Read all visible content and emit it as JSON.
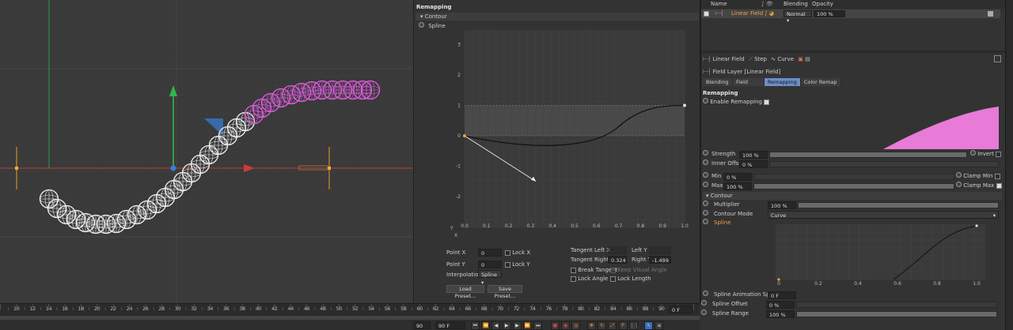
{
  "remap": {
    "title": "Remapping",
    "contour_header": "Contour",
    "spline_label": "Spline",
    "y_ticks": [
      "3",
      "2",
      "1",
      "0",
      "-1",
      "-2"
    ],
    "x_ticks": [
      "0.0",
      "0.1",
      "0.2",
      "0.3",
      "0.4",
      "0.5",
      "0.6",
      "0.7",
      "0.8",
      "0.9",
      "1.0"
    ],
    "axis_y": "Y",
    "axis_x": "X",
    "point_x_label": "Point X",
    "point_x_value": "0",
    "point_y_label": "Point Y",
    "point_y_value": "0",
    "lock_x": "Lock X",
    "lock_y": "Lock Y",
    "interp_label": "Interpolation",
    "interp_value": "Spline",
    "tangent_left_x_label": "Tangent Left X",
    "left_y_label": "Left Y",
    "tangent_right_x_label": "Tangent Right X",
    "tangent_right_x_value": "0.324",
    "right_y_label": "Right Y",
    "right_y_value": "-1.499",
    "break_tangent": "Break Tangent",
    "keep_visual_angle": "Keep Visual Angle",
    "lock_angle": "Lock Angle",
    "lock_length": "Lock Length",
    "load_preset": "Load Preset...",
    "save_preset": "Save Preset..."
  },
  "layers": {
    "col_name": "Name",
    "col_blending": "Blending",
    "col_opacity": "Opacity",
    "row_name": "Linear Field",
    "row_blending": "Normal",
    "row_opacity": "100 %"
  },
  "attr": {
    "breadcrumbs": [
      "Linear Field",
      "Step",
      "Curve"
    ],
    "object_title": "Field Layer [Linear Field]",
    "tabs": [
      "Blending",
      "Field",
      "Remapping",
      "Color Remap"
    ],
    "selected_tab": "Remapping",
    "section_title": "Remapping",
    "enable_remapping": "Enable Remapping",
    "strength_label": "Strength",
    "strength_value": "100 %",
    "invert_label": "Invert",
    "inner_offset_label": "Inner Offset",
    "inner_offset_value": "0 %",
    "min_label": "Min",
    "min_value": "0 %",
    "clamp_min": "Clamp Min",
    "max_label": "Max",
    "max_value": "100 %",
    "clamp_max": "Clamp Max",
    "contour_header": "Contour",
    "multiplier_label": "Multiplier",
    "multiplier_value": "100 %",
    "contour_mode_label": "Contour Mode",
    "contour_mode_value": "Curve",
    "spline_label": "Spline",
    "spline_ticks": [
      "0",
      "0.2",
      "0.4",
      "0.6",
      "0.8",
      "1.0"
    ],
    "spline_anim_label": "Spline Animation Speed",
    "spline_anim_value": "0 F",
    "spline_offset_label": "Spline Offset",
    "spline_offset_value": "0 %",
    "spline_range_label": "Spline Range",
    "spline_range_value": "100 %"
  },
  "timeline": {
    "ticks": [
      "10",
      "12",
      "14",
      "16",
      "18",
      "20",
      "22",
      "24",
      "26",
      "28",
      "30",
      "32",
      "34",
      "36",
      "38",
      "40",
      "42",
      "44",
      "46",
      "48",
      "50",
      "52",
      "54",
      "56",
      "58",
      "60",
      "62",
      "64",
      "66",
      "68",
      "70",
      "72",
      "74",
      "76",
      "78",
      "80",
      "82",
      "84",
      "86",
      "88",
      "90"
    ],
    "end_frame_a": "90 F",
    "end_frame_b": "90 F",
    "current_frame": "0 F"
  },
  "colors": {
    "accent_blue": "#6d8ec7",
    "sphere_pink": "#e05be0",
    "remap_fill": "#e87ad8",
    "axis_red": "#d03a3a",
    "axis_green": "#2fb84f"
  }
}
